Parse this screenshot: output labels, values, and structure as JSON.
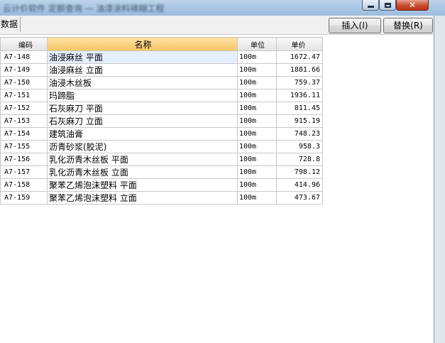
{
  "window": {
    "title": "云计价软件 定额查询 — 油漆涂料裱糊工程"
  },
  "toolbar": {
    "tab_label": "数据",
    "insert_label": "插入(I)",
    "replace_label": "替换(R)"
  },
  "table": {
    "columns": [
      "编码",
      "名称",
      "单位",
      "单价"
    ],
    "rows": [
      {
        "code": "A7-148",
        "name": "油浸麻丝 平面",
        "unit": "100m",
        "price": "1672.47"
      },
      {
        "code": "A7-149",
        "name": "油浸麻丝 立面",
        "unit": "100m",
        "price": "1881.66"
      },
      {
        "code": "A7-150",
        "name": "油浸木丝板",
        "unit": "100m",
        "price": "759.37"
      },
      {
        "code": "A7-151",
        "name": "玛蹄脂",
        "unit": "100m",
        "price": "1936.11"
      },
      {
        "code": "A7-152",
        "name": "石灰麻刀 平面",
        "unit": "100m",
        "price": "811.45"
      },
      {
        "code": "A7-153",
        "name": "石灰麻刀 立面",
        "unit": "100m",
        "price": "915.19"
      },
      {
        "code": "A7-154",
        "name": "建筑油膏",
        "unit": "100m",
        "price": "748.23"
      },
      {
        "code": "A7-155",
        "name": "沥青砂浆(胶泥)",
        "unit": "100m",
        "price": "958.3"
      },
      {
        "code": "A7-156",
        "name": "乳化沥青木丝板 平面",
        "unit": "100m",
        "price": "728.8"
      },
      {
        "code": "A7-157",
        "name": "乳化沥青木丝板 立面",
        "unit": "100m",
        "price": "798.12"
      },
      {
        "code": "A7-158",
        "name": "聚苯乙烯泡沫塑料 平面",
        "unit": "100m",
        "price": "414.96"
      },
      {
        "code": "A7-159",
        "name": "聚苯乙烯泡沫塑料 立面",
        "unit": "100m",
        "price": "473.67"
      }
    ]
  }
}
